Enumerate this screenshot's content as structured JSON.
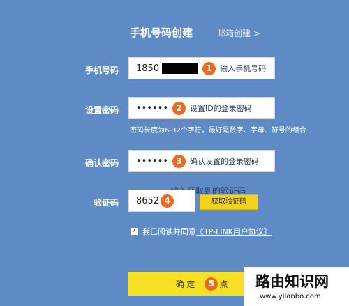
{
  "header": {
    "title": "手机号码创建",
    "email_link": "邮箱创建 >"
  },
  "phone": {
    "label": "手机号码",
    "value": "1850",
    "step": "1",
    "note": "输入手机号码"
  },
  "password": {
    "label": "设置密码",
    "value": "••••••",
    "step": "2",
    "note": "设置ID的登录密码",
    "hint": "密码长度为6-32个字符，最好是数字、字母、符号的组合"
  },
  "confirm": {
    "label": "确认密码",
    "value": "••••••",
    "step": "3",
    "note": "确认设置的登录密码"
  },
  "captcha": {
    "label": "验证码",
    "value": "8652",
    "step": "4",
    "note": "输入获取到的验证码",
    "button": "获取验证码"
  },
  "agreement": {
    "text": "我已阅读并同意",
    "link": "《TP-LINK用户协议》",
    "checked": true
  },
  "submit": {
    "label": "确 定",
    "step": "5",
    "note": "点"
  },
  "watermark": {
    "title": "路由知识网",
    "url": "www.yilanbo.com"
  }
}
